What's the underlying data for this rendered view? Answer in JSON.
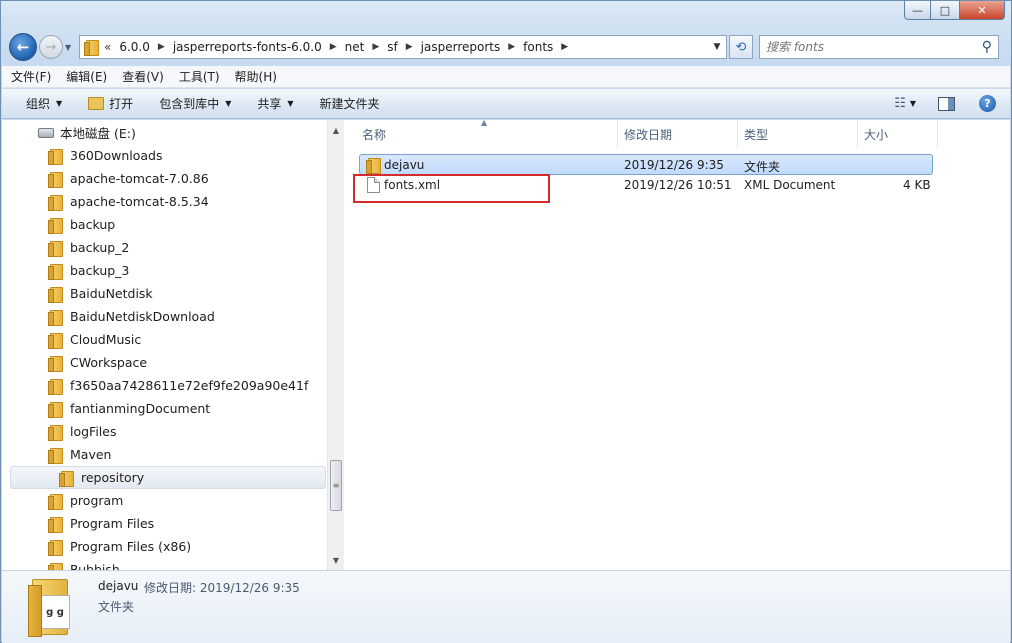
{
  "window": {
    "minimize_glyph": "—",
    "maximize_glyph": "□",
    "close_glyph": "✕"
  },
  "nav": {
    "back_glyph": "←",
    "forward_glyph": "→",
    "overflow": "«",
    "breadcrumb": [
      "6.0.0",
      "jasperreports-fonts-6.0.0",
      "net",
      "sf",
      "jasperreports",
      "fonts"
    ],
    "search_placeholder": "搜索 fonts"
  },
  "menu": [
    "文件(F)",
    "编辑(E)",
    "查看(V)",
    "工具(T)",
    "帮助(H)"
  ],
  "toolbar": {
    "organize": "组织",
    "open": "打开",
    "include_in_library": "包含到库中",
    "share": "共享",
    "new_folder": "新建文件夹"
  },
  "tree": {
    "drive": "本地磁盘 (E:)",
    "folders": [
      "360Downloads",
      "apache-tomcat-7.0.86",
      "apache-tomcat-8.5.34",
      "backup",
      "backup_2",
      "backup_3",
      "BaiduNetdisk",
      "BaiduNetdiskDownload",
      "CloudMusic",
      "CWorkspace",
      "f3650aa7428611e72ef9fe209a90e41f",
      "fantianmingDocument",
      "logFiles",
      "Maven",
      "repository",
      "program",
      "Program Files",
      "Program Files (x86)",
      "Rubbish"
    ],
    "selected": "repository"
  },
  "columns": [
    "名称",
    "修改日期",
    "类型",
    "大小"
  ],
  "files": [
    {
      "name": "dejavu",
      "date": "2019/12/26 9:35",
      "type": "文件夹",
      "size": "",
      "kind": "folder",
      "selected": true
    },
    {
      "name": "fonts.xml",
      "date": "2019/12/26 10:51",
      "type": "XML Document",
      "size": "4 KB",
      "kind": "file",
      "selected": false
    }
  ],
  "details": {
    "name": "dejavu",
    "modified": "修改日期: 2019/12/26 9:35",
    "type": "文件夹",
    "thumb_text": "g g"
  },
  "colors": {
    "highlight_box": "#d62b2b",
    "selection": "#c1dbfc"
  }
}
